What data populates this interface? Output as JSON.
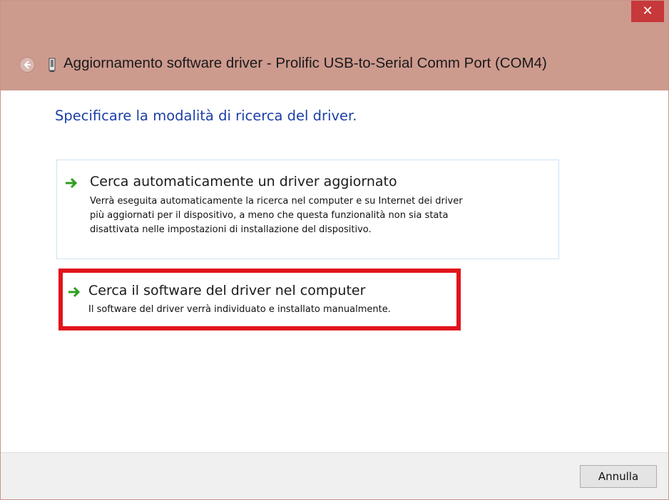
{
  "window": {
    "title": "Aggiornamento software driver - Prolific USB-to-Serial Comm Port (COM4)",
    "close_symbol": "✕"
  },
  "icons": {
    "back": "back-arrow-icon",
    "device": "usb-device-icon",
    "option_arrow": "green-arrow-icon",
    "close": "close-icon"
  },
  "main": {
    "heading": "Specificare la modalità di ricerca del driver.",
    "options": [
      {
        "title": "Cerca automaticamente un driver aggiornato",
        "description_lines": [
          "Verrà eseguita automaticamente la ricerca nel computer e su Internet dei driver",
          "più aggiornati per il dispositivo, a meno che questa funzionalità non sia stata",
          "disattivata nelle impostazioni di installazione del dispositivo."
        ]
      },
      {
        "title": "Cerca il software del driver nel computer",
        "description_lines": [
          "Il software del driver verrà individuato e installato manualmente."
        ],
        "highlighted": true
      }
    ]
  },
  "footer": {
    "cancel_label": "Annulla"
  },
  "colors": {
    "titlebar": "#cd9a8e",
    "close_button": "#c7383a",
    "heading": "#1c3fa8",
    "highlight_border": "#e0141c",
    "arrow": "#2e9e1f"
  }
}
